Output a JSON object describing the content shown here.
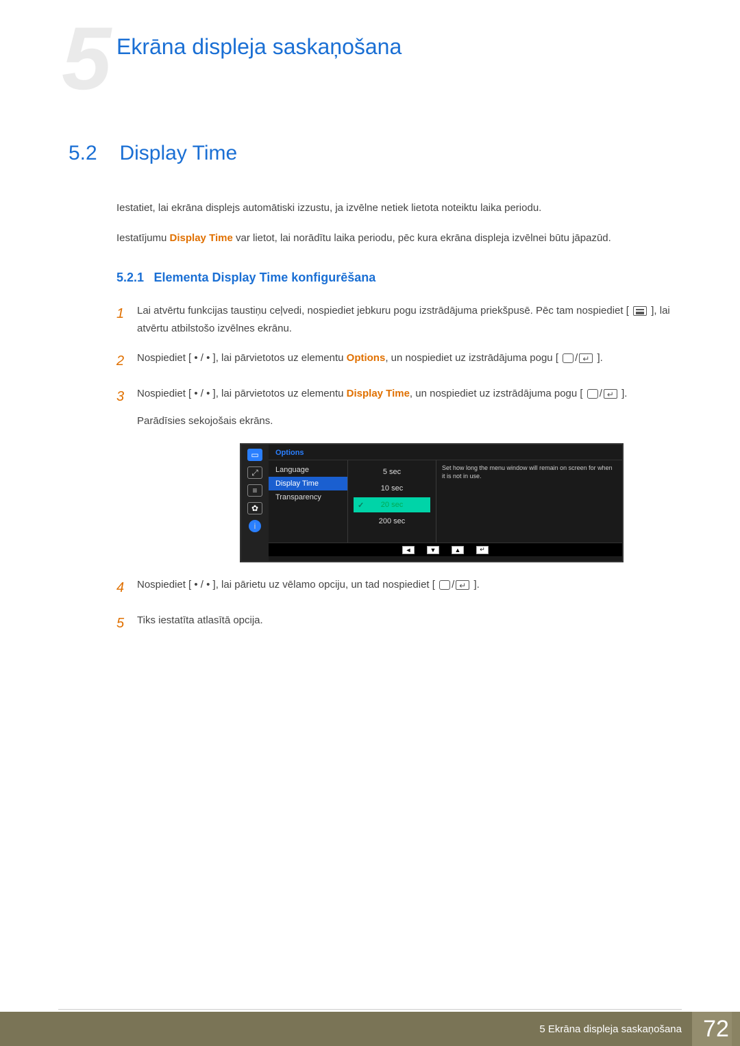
{
  "chapter_bg": "5",
  "chapter_title": "Ekrāna displeja saskaņošana",
  "section": {
    "num": "5.2",
    "title": "Display Time"
  },
  "intro": {
    "p1": "Iestatiet, lai ekrāna displejs automātiski izzustu, ja izvēlne netiek lietota noteiktu laika periodu.",
    "p2_pre": "Iestatījumu ",
    "p2_em": "Display Time",
    "p2_post": " var lietot, lai norādītu laika periodu, pēc kura ekrāna displeja izvēlnei būtu jāpazūd."
  },
  "subsection": {
    "num": "5.2.1",
    "title": "Elementa Display Time konfigurēšana"
  },
  "steps": {
    "s1": {
      "num": "1",
      "a": "Lai atvērtu funkcijas taustiņu ceļvedi, nospiediet jebkuru pogu izstrādājuma priekšpusē. Pēc tam nospiediet [",
      "b": "], lai atvērtu atbilstošo izvēlnes ekrānu."
    },
    "s2": {
      "num": "2",
      "a": "Nospiediet [ • / • ], lai pārvietotos uz elementu ",
      "em": "Options",
      "b": ", un nospiediet uz izstrādājuma pogu [",
      "c": "]."
    },
    "s3": {
      "num": "3",
      "a": "Nospiediet [ • / • ], lai pārvietotos uz elementu ",
      "em": "Display Time",
      "b": ", un nospiediet uz izstrādājuma pogu [",
      "c": "].",
      "d": "Parādīsies sekojošais ekrāns."
    },
    "s4": {
      "num": "4",
      "a": "Nospiediet [ • / • ], lai pārietu uz vēlamo opciju, un tad nospiediet [",
      "b": "]."
    },
    "s5": {
      "num": "5",
      "a": "Tiks iestatīta atlasītā opcija."
    }
  },
  "osd": {
    "header": "Options",
    "menu": {
      "m1": "Language",
      "m2": "Display Time",
      "m3": "Transparency"
    },
    "values": {
      "v1": "5 sec",
      "v2": "10 sec",
      "v3": "20 sec",
      "v4": "200 sec"
    },
    "desc": "Set how long the menu window will remain on screen for when it is not in use.",
    "nav": {
      "left": "◄",
      "down": "▼",
      "up": "▲",
      "enter": "↵"
    }
  },
  "footer": {
    "text": "5 Ekrāna displeja saskaņošana",
    "page": "72"
  }
}
